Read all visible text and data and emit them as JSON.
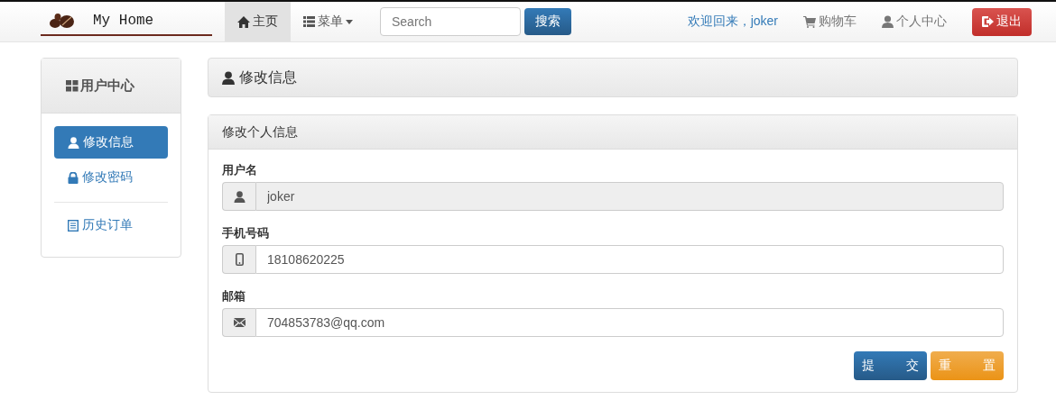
{
  "navbar": {
    "brand": "My Home",
    "nav_items": [
      {
        "label": "主页",
        "kind": "home",
        "selected": true
      },
      {
        "label": "菜单",
        "kind": "menu",
        "selected": false
      }
    ],
    "search": {
      "placeholder": "Search",
      "button": "搜索"
    },
    "welcome": "欢迎回来，joker",
    "right_links": [
      {
        "label": "购物车",
        "kind": "cart"
      },
      {
        "label": "个人中心",
        "kind": "profile"
      }
    ],
    "logout": "退出"
  },
  "sidebar": {
    "title": "用户中心",
    "items": [
      {
        "label": "修改信息",
        "kind": "profile",
        "selected": true
      },
      {
        "label": "修改密码",
        "kind": "password",
        "selected": false
      },
      {
        "label": "历史订单",
        "kind": "orders",
        "selected": false
      }
    ]
  },
  "page_header": {
    "title": "修改信息"
  },
  "form_panel": {
    "title": "修改个人信息",
    "fields": [
      {
        "label": "用户名",
        "kind": "username",
        "value": "joker",
        "disabled": true
      },
      {
        "label": "手机号码",
        "kind": "phone",
        "value": "18108620225",
        "disabled": false
      },
      {
        "label": "邮箱",
        "kind": "email",
        "value": "704853783@qq.com",
        "disabled": false
      }
    ],
    "buttons": [
      {
        "label": "提 交",
        "kind": "primary"
      },
      {
        "label": "重 置",
        "kind": "warning"
      }
    ]
  }
}
